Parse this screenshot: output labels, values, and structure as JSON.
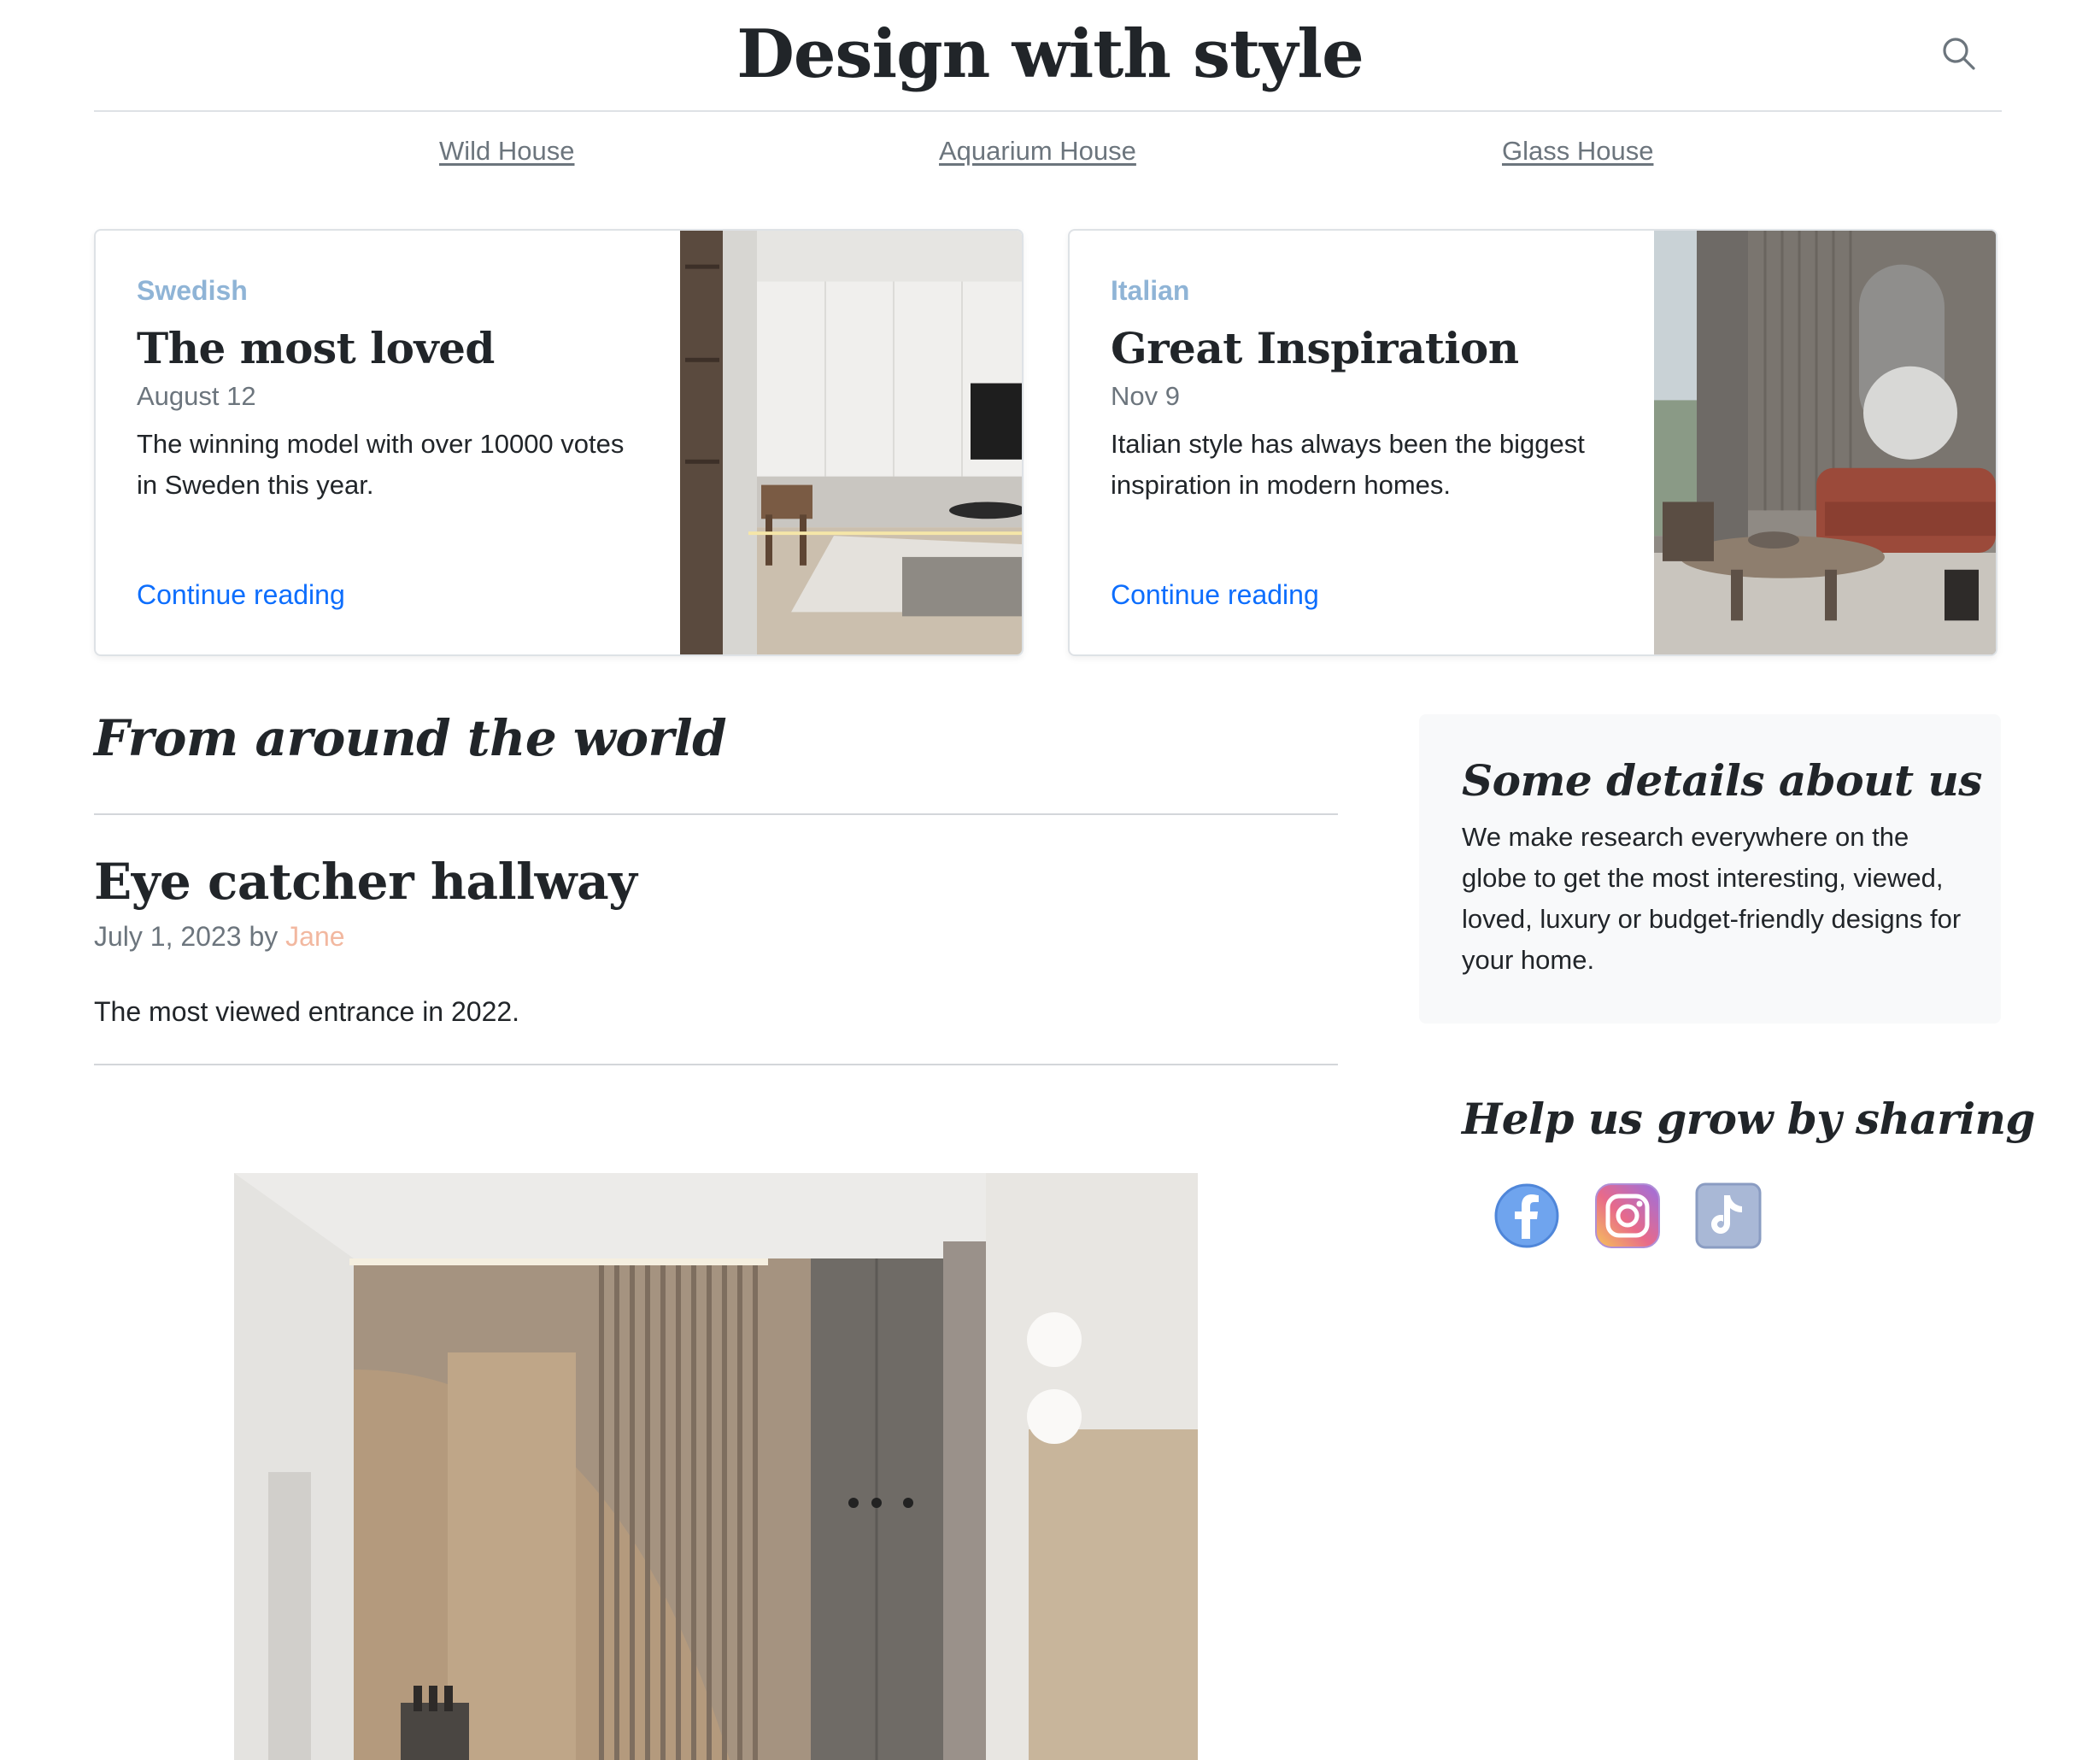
{
  "header": {
    "title": "Design with style",
    "search_icon": "search-icon"
  },
  "nav": {
    "links": [
      {
        "label": "Wild House"
      },
      {
        "label": "Aquarium House"
      },
      {
        "label": "Glass House"
      }
    ]
  },
  "featured": [
    {
      "category": "Swedish",
      "title": "The most loved",
      "date": "August 12",
      "text": "The winning model with over 10000 votes in Sweden this year.",
      "link": "Continue reading"
    },
    {
      "category": "Italian",
      "title": "Great Inspiration",
      "date": "Nov 9",
      "text": "Italian style has always been the biggest inspiration in modern homes.",
      "link": "Continue reading"
    }
  ],
  "main": {
    "section_heading": "From around the world",
    "post": {
      "title": "Eye catcher hallway",
      "date": "July 1, 2023",
      "by": "by",
      "author": "Jane",
      "excerpt": "The most viewed entrance in 2022."
    }
  },
  "sidebar": {
    "about_title": "Some details about us",
    "about_text": "We make research everywhere on the globe to get the most interesting, viewed, loved, luxury or budget-friendly designs for your home.",
    "share_title": "Help us grow by sharing",
    "social_icons": [
      "facebook-icon",
      "instagram-icon",
      "tiktok-icon"
    ]
  },
  "colors": {
    "category": "#8fb4d6",
    "link": "#0d6efd",
    "author": "#f2b8a0",
    "muted": "#6c757d",
    "sidebar_bg": "#f8f9fa",
    "border": "#dee2e6"
  }
}
